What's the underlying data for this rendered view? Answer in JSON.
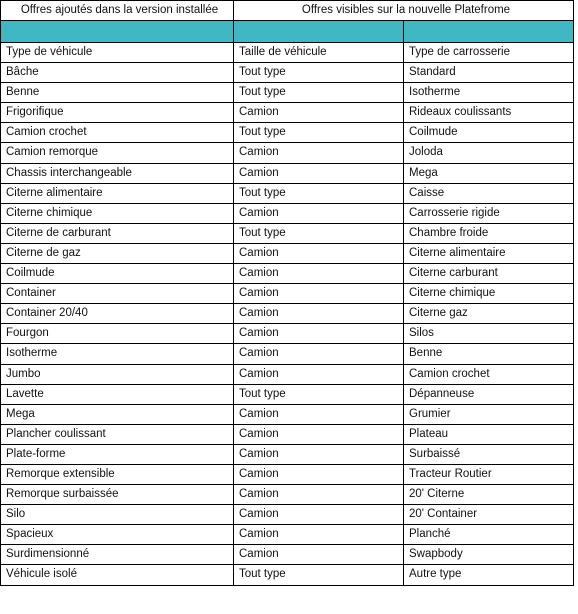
{
  "header": {
    "left_title": "Offres ajoutés dans la version installée",
    "right_title": "Offres visibles sur la nouvelle Platefrome"
  },
  "colors": {
    "band": "#3fb8c4",
    "border": "#000000",
    "text": "#111111",
    "background": "#ffffff"
  },
  "band": {
    "left_cell": "",
    "middle_cell": "",
    "right_cell": ""
  },
  "columns": [
    "Type de véhicule",
    "Taille de véhicule",
    "Type de carrosserie"
  ],
  "rows": [
    [
      "Type de véhicule",
      "Taille de véhicule",
      "Type de carrosserie"
    ],
    [
      "Bâche",
      "Tout type",
      "Standard"
    ],
    [
      "Benne",
      "Tout type",
      "Isotherme"
    ],
    [
      "Frigorifique",
      "Camion",
      "Rideaux coulissants"
    ],
    [
      "Camion crochet",
      "Tout type",
      "Coilmude"
    ],
    [
      "Camion remorque",
      "Camion",
      "Joloda"
    ],
    [
      "Chassis interchangeable",
      "Camion",
      "Mega"
    ],
    [
      "Citerne alimentaire",
      "Tout type",
      "Caisse"
    ],
    [
      "Citerne chimique",
      "Camion",
      "Carrosserie rigide"
    ],
    [
      "Citerne de carburant",
      "Tout type",
      "Chambre froide"
    ],
    [
      "Citerne de gaz",
      "Camion",
      "Citerne alimentaire"
    ],
    [
      "Coilmude",
      "Camion",
      "Citerne carburant"
    ],
    [
      "Container",
      "Camion",
      "Citerne chimique"
    ],
    [
      "Container 20/40",
      "Camion",
      "Citerne gaz"
    ],
    [
      "Fourgon",
      "Camion",
      "Silos"
    ],
    [
      "Isotherme",
      "Camion",
      "Benne"
    ],
    [
      "Jumbo",
      "Camion",
      "Camion crochet"
    ],
    [
      "Lavette",
      "Tout type",
      "Dépanneuse"
    ],
    [
      "Mega",
      "Camion",
      "Grumier"
    ],
    [
      "Plancher coulissant",
      "Camion",
      "Plateau"
    ],
    [
      "Plate-forme",
      "Camion",
      "Surbaissé"
    ],
    [
      "Remorque extensible",
      "Camion",
      "Tracteur Routier"
    ],
    [
      "Remorque surbaissée",
      "Camion",
      "20' Citerne"
    ],
    [
      "Silo",
      "Camion",
      "20' Container"
    ],
    [
      "Spacieux",
      "Camion",
      "Planché"
    ],
    [
      "Surdimensionné",
      "Camion",
      "Swapbody"
    ],
    [
      "Véhicule isolé",
      "Tout type",
      "Autre type"
    ]
  ]
}
